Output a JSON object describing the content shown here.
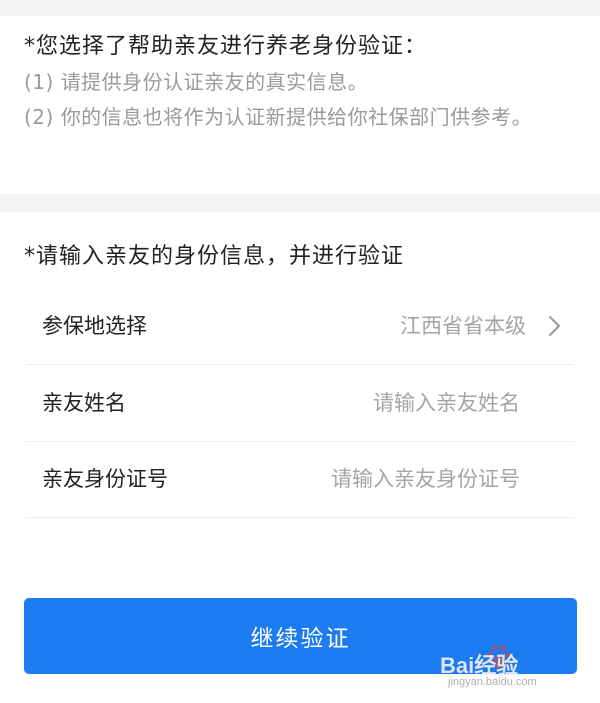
{
  "notice": {
    "title": "*您选择了帮助亲友进行养老身份验证：",
    "lines": [
      "(1) 请提供身份认证亲友的真实信息。",
      "(2) 你的信息也将作为认证新提供给你社保部门供参考。"
    ]
  },
  "form": {
    "title": "*请输入亲友的身份信息，并进行验证",
    "rows": [
      {
        "label": "参保地选择",
        "value": "江西省省本级"
      },
      {
        "label": "亲友姓名",
        "placeholder": "请输入亲友姓名"
      },
      {
        "label": "亲友身份证号",
        "placeholder": "请输入亲友身份证号"
      }
    ],
    "submit_label": "继续验证"
  },
  "colors": {
    "accent": "#1c7bf0",
    "background_gray": "#f4f4f6",
    "text_primary": "#222222",
    "text_muted": "#9a9a9a"
  },
  "icons": {
    "select_arrow": "chevron-right-icon"
  },
  "watermark": {
    "brand": "Bai经验",
    "url": "jingyan.baidu.com"
  }
}
